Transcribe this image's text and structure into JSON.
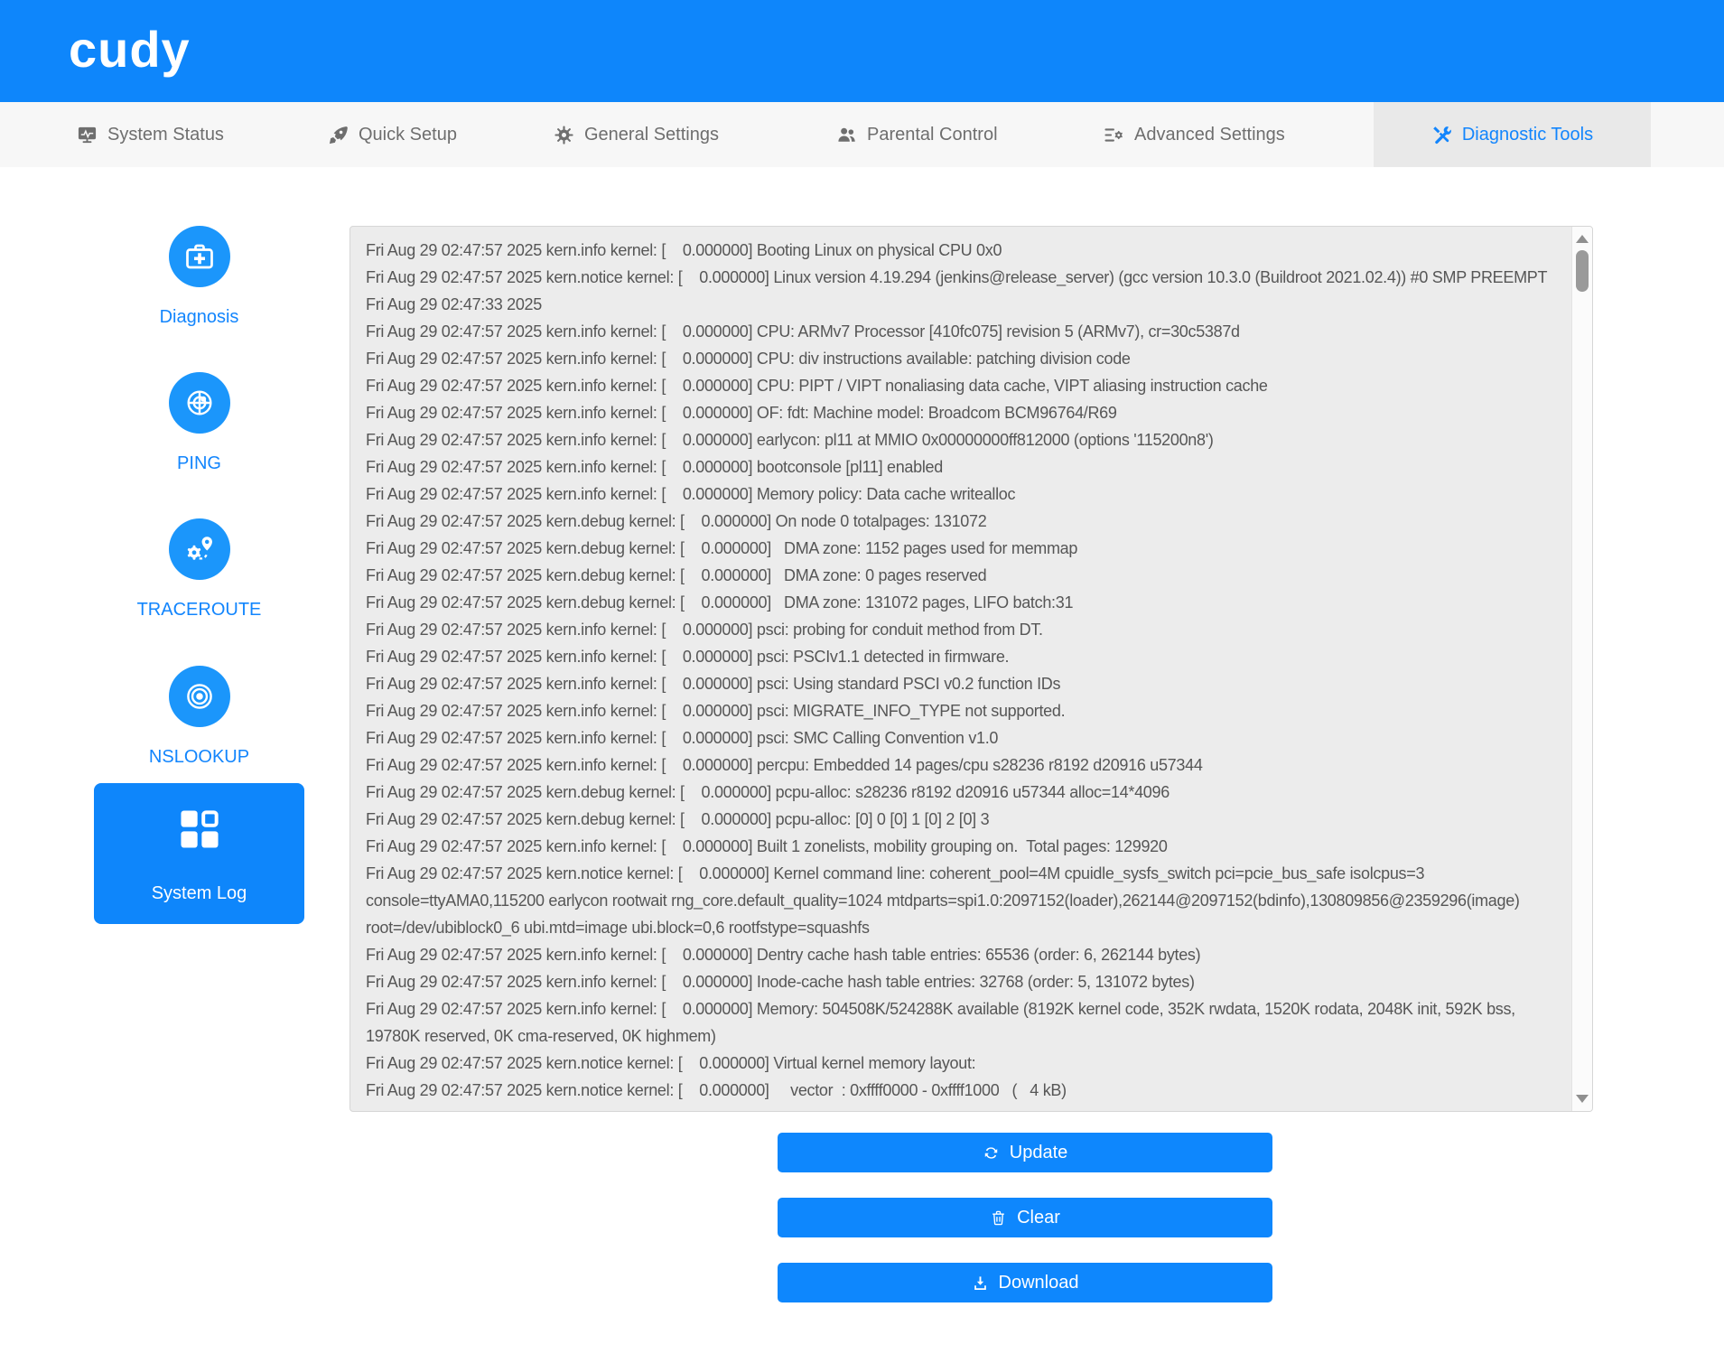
{
  "header": {
    "logo": "cudy",
    "background": "#0e86fb"
  },
  "nav": {
    "background": "#f7f7f7",
    "active_background": "#e9e9e9",
    "text_color": "#6e6e6e",
    "active_text_color": "#1285fd",
    "items": [
      {
        "label": "System Status",
        "icon": "system-status-icon",
        "active": false
      },
      {
        "label": "Quick Setup",
        "icon": "rocket-icon",
        "active": false
      },
      {
        "label": "General Settings",
        "icon": "gear-icon",
        "active": false
      },
      {
        "label": "Parental Control",
        "icon": "users-icon",
        "active": false
      },
      {
        "label": "Advanced Settings",
        "icon": "sliders-gear-icon",
        "active": false
      },
      {
        "label": "Diagnostic Tools",
        "icon": "wrench-screwdriver-icon",
        "active": true
      }
    ]
  },
  "sidebar": {
    "items": [
      {
        "label": "Diagnosis",
        "icon": "first-aid-icon"
      },
      {
        "label": "PING",
        "icon": "radar-icon"
      },
      {
        "label": "TRACEROUTE",
        "icon": "route-pin-gear-icon"
      },
      {
        "label": "NSLOOKUP",
        "icon": "concentric-eye-icon"
      }
    ],
    "active_tile": {
      "label": "System Log",
      "icon": "grid-icon",
      "background": "#0e86fb"
    },
    "circle_color": "#1b96fb",
    "label_color": "#1285fd"
  },
  "log": {
    "lines": [
      "Fri Aug 29 02:47:57 2025 kern.info kernel: [    0.000000] Booting Linux on physical CPU 0x0",
      "Fri Aug 29 02:47:57 2025 kern.notice kernel: [    0.000000] Linux version 4.19.294 (jenkins@release_server) (gcc version 10.3.0 (Buildroot 2021.02.4)) #0 SMP PREEMPT Fri Aug 29 02:47:33 2025",
      "Fri Aug 29 02:47:57 2025 kern.info kernel: [    0.000000] CPU: ARMv7 Processor [410fc075] revision 5 (ARMv7), cr=30c5387d",
      "Fri Aug 29 02:47:57 2025 kern.info kernel: [    0.000000] CPU: div instructions available: patching division code",
      "Fri Aug 29 02:47:57 2025 kern.info kernel: [    0.000000] CPU: PIPT / VIPT nonaliasing data cache, VIPT aliasing instruction cache",
      "Fri Aug 29 02:47:57 2025 kern.info kernel: [    0.000000] OF: fdt: Machine model: Broadcom BCM96764/R69",
      "Fri Aug 29 02:47:57 2025 kern.info kernel: [    0.000000] earlycon: pl11 at MMIO 0x00000000ff812000 (options '115200n8')",
      "Fri Aug 29 02:47:57 2025 kern.info kernel: [    0.000000] bootconsole [pl11] enabled",
      "Fri Aug 29 02:47:57 2025 kern.info kernel: [    0.000000] Memory policy: Data cache writealloc",
      "Fri Aug 29 02:47:57 2025 kern.debug kernel: [    0.000000] On node 0 totalpages: 131072",
      "Fri Aug 29 02:47:57 2025 kern.debug kernel: [    0.000000]   DMA zone: 1152 pages used for memmap",
      "Fri Aug 29 02:47:57 2025 kern.debug kernel: [    0.000000]   DMA zone: 0 pages reserved",
      "Fri Aug 29 02:47:57 2025 kern.debug kernel: [    0.000000]   DMA zone: 131072 pages, LIFO batch:31",
      "Fri Aug 29 02:47:57 2025 kern.info kernel: [    0.000000] psci: probing for conduit method from DT.",
      "Fri Aug 29 02:47:57 2025 kern.info kernel: [    0.000000] psci: PSCIv1.1 detected in firmware.",
      "Fri Aug 29 02:47:57 2025 kern.info kernel: [    0.000000] psci: Using standard PSCI v0.2 function IDs",
      "Fri Aug 29 02:47:57 2025 kern.info kernel: [    0.000000] psci: MIGRATE_INFO_TYPE not supported.",
      "Fri Aug 29 02:47:57 2025 kern.info kernel: [    0.000000] psci: SMC Calling Convention v1.0",
      "Fri Aug 29 02:47:57 2025 kern.info kernel: [    0.000000] percpu: Embedded 14 pages/cpu s28236 r8192 d20916 u57344",
      "Fri Aug 29 02:47:57 2025 kern.debug kernel: [    0.000000] pcpu-alloc: s28236 r8192 d20916 u57344 alloc=14*4096",
      "Fri Aug 29 02:47:57 2025 kern.debug kernel: [    0.000000] pcpu-alloc: [0] 0 [0] 1 [0] 2 [0] 3",
      "Fri Aug 29 02:47:57 2025 kern.info kernel: [    0.000000] Built 1 zonelists, mobility grouping on.  Total pages: 129920",
      "Fri Aug 29 02:47:57 2025 kern.notice kernel: [    0.000000] Kernel command line: coherent_pool=4M cpuidle_sysfs_switch pci=pcie_bus_safe isolcpus=3 console=ttyAMA0,115200 earlycon rootwait rng_core.default_quality=1024 mtdparts=spi1.0:2097152(loader),262144@2097152(bdinfo),130809856@2359296(image) root=/dev/ubiblock0_6 ubi.mtd=image ubi.block=0,6 rootfstype=squashfs",
      "Fri Aug 29 02:47:57 2025 kern.info kernel: [    0.000000] Dentry cache hash table entries: 65536 (order: 6, 262144 bytes)",
      "Fri Aug 29 02:47:57 2025 kern.info kernel: [    0.000000] Inode-cache hash table entries: 32768 (order: 5, 131072 bytes)",
      "Fri Aug 29 02:47:57 2025 kern.info kernel: [    0.000000] Memory: 504508K/524288K available (8192K kernel code, 352K rwdata, 1520K rodata, 2048K init, 592K bss, 19780K reserved, 0K cma-reserved, 0K highmem)",
      "Fri Aug 29 02:47:57 2025 kern.notice kernel: [    0.000000] Virtual kernel memory layout:",
      "Fri Aug 29 02:47:57 2025 kern.notice kernel: [    0.000000]     vector  : 0xffff0000 - 0xffff1000   (   4 kB)"
    ]
  },
  "actions": [
    {
      "label": "Update",
      "icon": "refresh-icon"
    },
    {
      "label": "Clear",
      "icon": "trash-icon"
    },
    {
      "label": "Download",
      "icon": "download-icon"
    }
  ],
  "colors": {
    "brand_blue": "#0e86fb",
    "sidebar_circle_blue": "#1b96fb",
    "link_blue": "#1285fd",
    "log_background": "#ececec",
    "log_text": "#565656"
  }
}
